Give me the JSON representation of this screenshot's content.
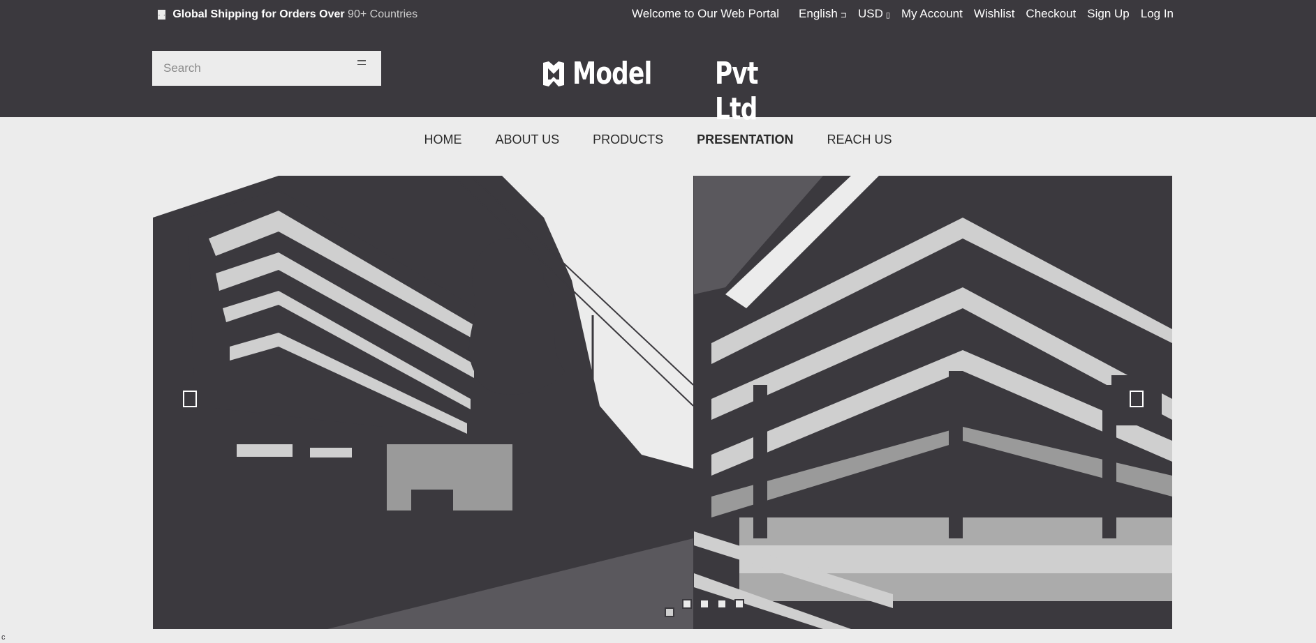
{
  "topbar": {
    "shipping_prefix": "Global Shipping for Orders Over",
    "shipping_suffix": "90+ Countries",
    "welcome": "Welcome to Our Web Portal",
    "language": "English",
    "currency": "USD",
    "links": [
      "My Account",
      "Wishlist",
      "Checkout",
      "Sign Up",
      "Log In"
    ]
  },
  "search": {
    "placeholder": "Search"
  },
  "logo": {
    "word1": "Model",
    "word2": "Pvt Ltd"
  },
  "nav": {
    "items": [
      "HOME",
      "ABOUT US",
      "PRODUCTS",
      "PRESENTATION",
      "REACH US"
    ]
  },
  "slider": {
    "dot_count": 5,
    "active_index": 0
  },
  "footer_char": "c",
  "colors": {
    "dark": "#3b393e",
    "light": "#ececec",
    "white": "#ffffff"
  }
}
